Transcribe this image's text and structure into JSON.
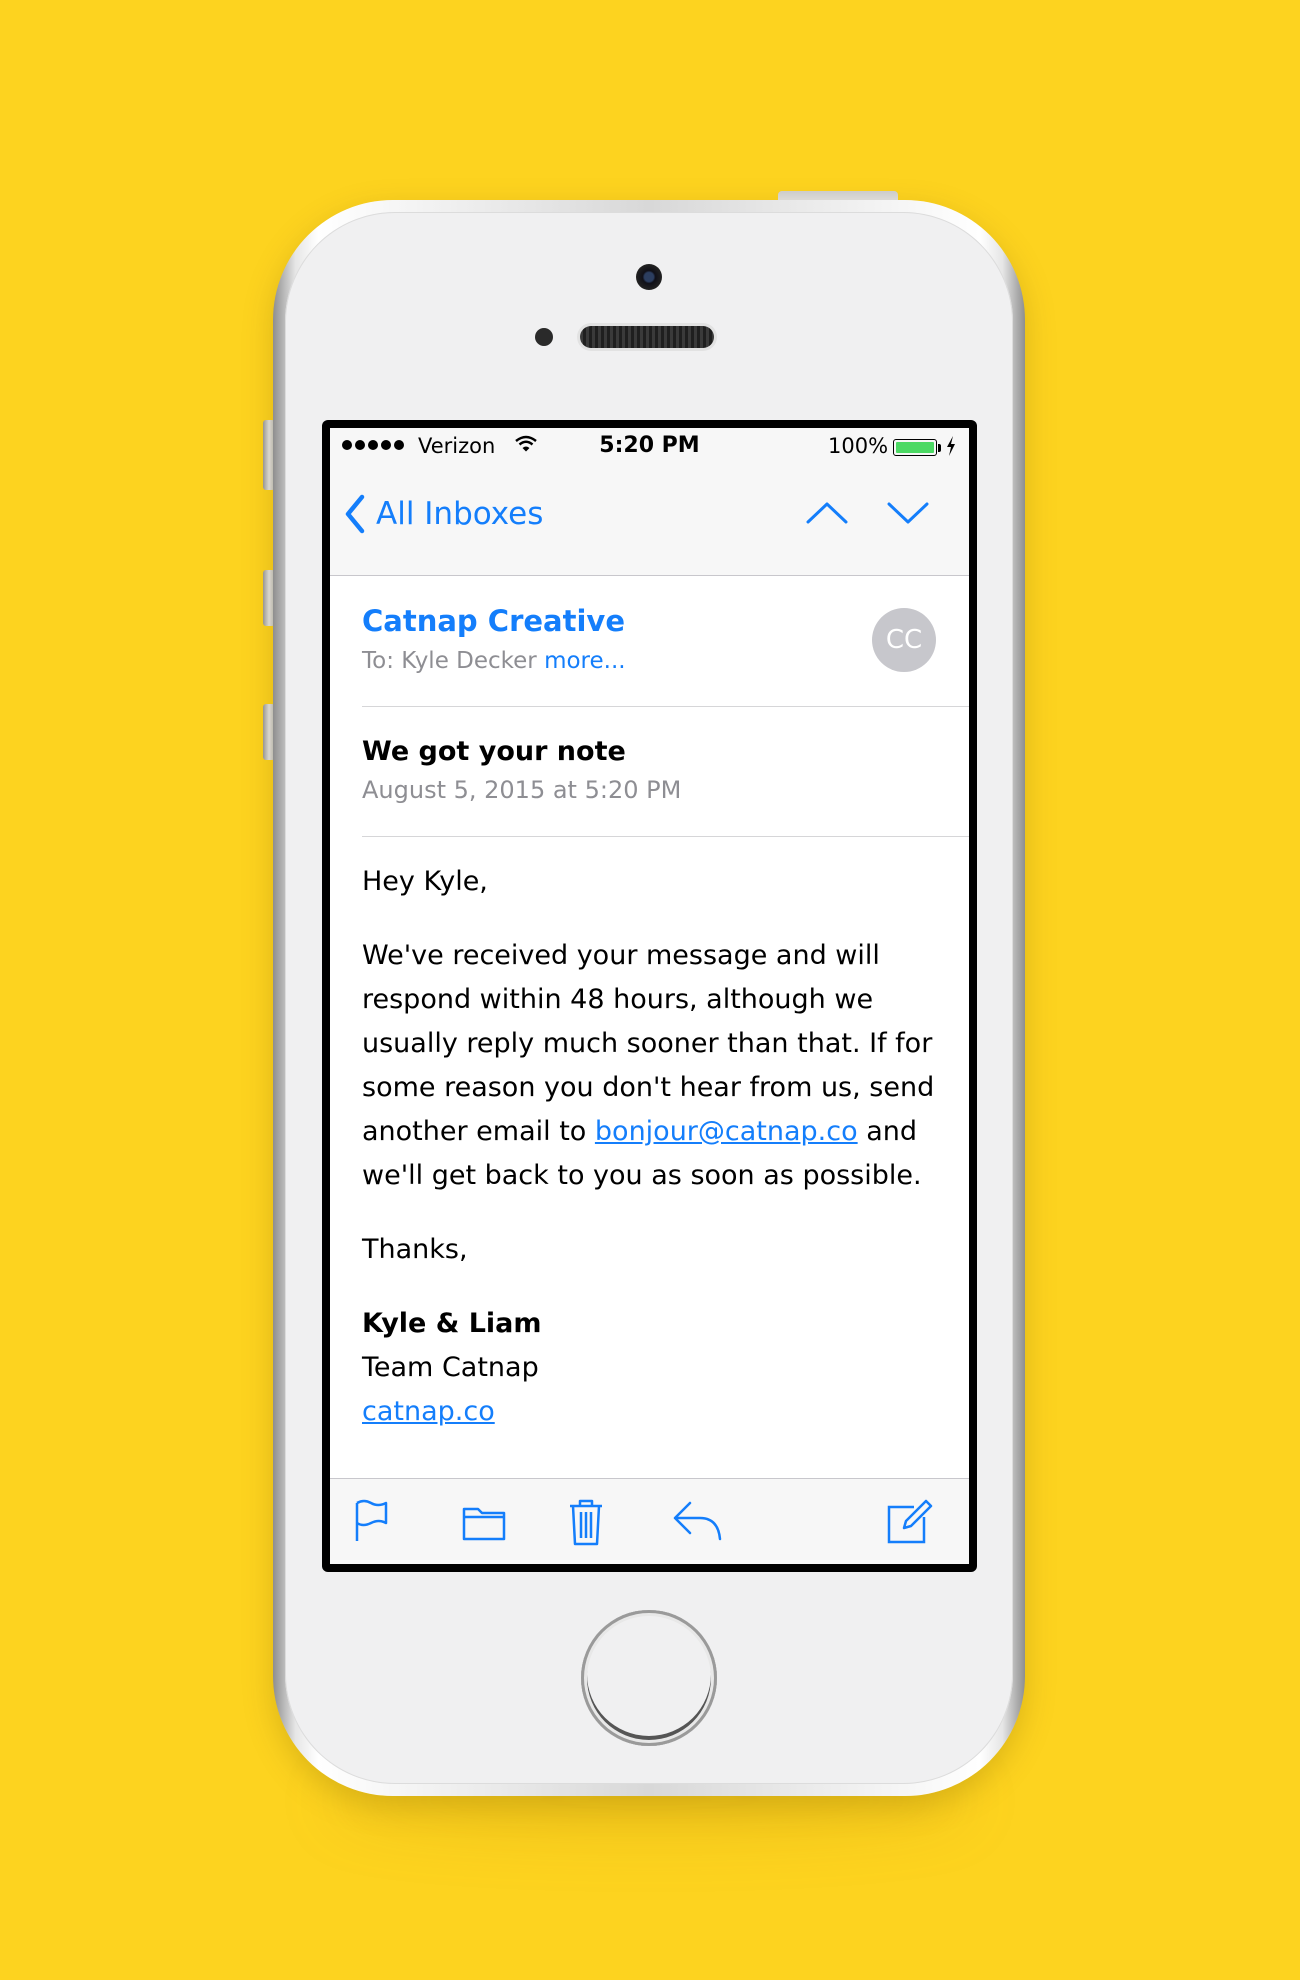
{
  "theme": {
    "background": "#FDD31F",
    "accent": "#147EFB",
    "battery_green": "#4CD964"
  },
  "status_bar": {
    "carrier": "Verizon",
    "time": "5:20 PM",
    "battery_percent": "100%",
    "battery_level": 1.0
  },
  "nav": {
    "back_label": "All Inboxes"
  },
  "message": {
    "sender": "Catnap Creative",
    "to_prefix": "To:",
    "to_name": "Kyle Decker",
    "more_label": "more...",
    "avatar_initials": "CC",
    "subject": "We got your note",
    "date": "August 5, 2015 at 5:20 PM"
  },
  "body": {
    "greeting": "Hey Kyle,",
    "para_text_1": "We've received your message and will respond within 48 hours, although we usually reply much sooner than that. If for some reason you don't hear from us, send another email to ",
    "email_link": "bonjour@catnap.co",
    "para_text_2": " and we'll get back to you as soon as possible.",
    "thanks": "Thanks,",
    "signature_names": "Kyle & Liam",
    "signature_team": "Team Catnap",
    "signature_link": "catnap.co"
  },
  "toolbar": {
    "icons": [
      "flag-icon",
      "folder-icon",
      "trash-icon",
      "reply-icon",
      "compose-icon"
    ]
  }
}
